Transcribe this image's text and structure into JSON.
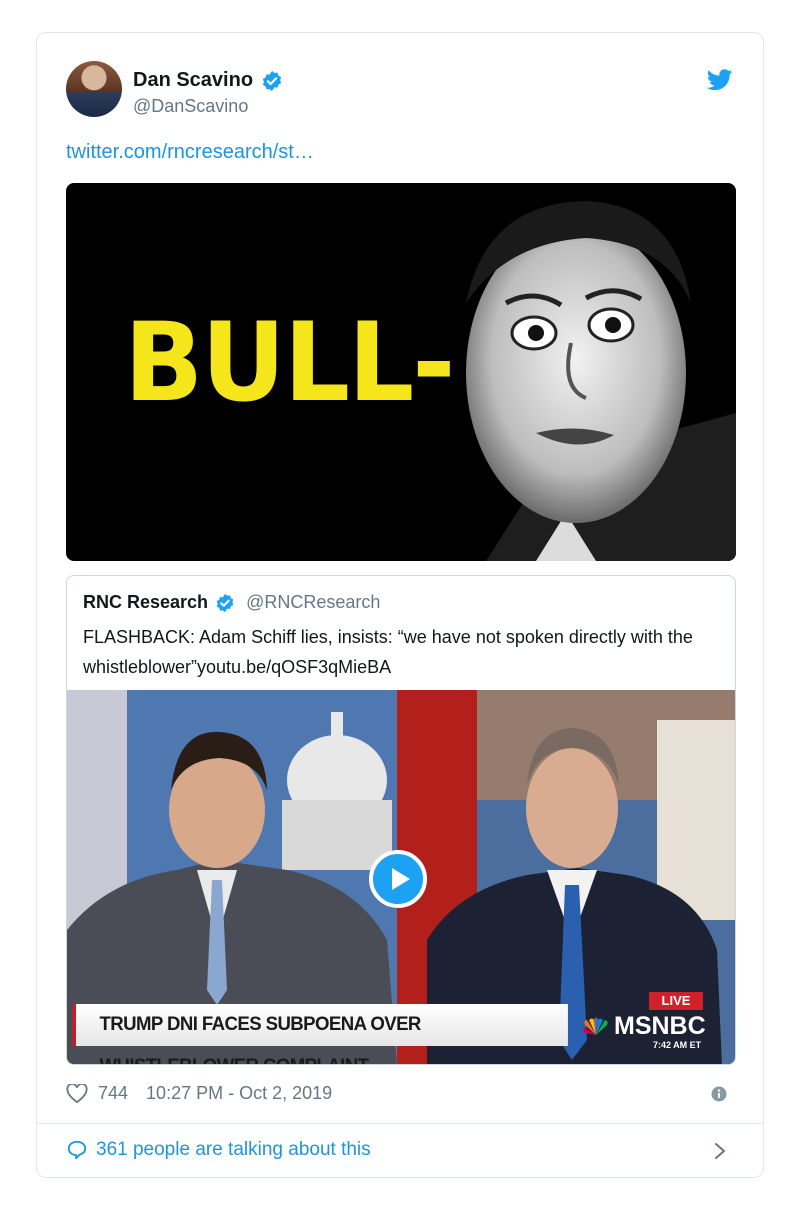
{
  "author": {
    "name": "Dan Scavino",
    "handle": "@DanScavino"
  },
  "tweet": {
    "link_text": "twitter.com/rncresearch/st…"
  },
  "image_text": "BULL-",
  "quoted": {
    "name": "RNC Research",
    "handle": "@RNCResearch",
    "text": "FLASHBACK: Adam Schiff lies, insists: “we have not spoken directly with the whistleblower”youtu.be/qOSF3qMieBA",
    "video": {
      "chyron": "TRUMP DNI FACES SUBPOENA OVER WHISTLEBLOWER COMPLAINT",
      "live_label": "LIVE",
      "network": "MSNBC",
      "timestamp": "7:42 AM ET"
    }
  },
  "meta": {
    "likes": "744",
    "time": "10:27 PM - Oct 2, 2019"
  },
  "footer": {
    "talking": "361 people are talking about this"
  },
  "colors": {
    "accent": "#1da1f2",
    "link": "#1b95e0",
    "muted": "#657786",
    "bull_yellow": "#f5e61c"
  },
  "icons": [
    "verified-icon",
    "twitter-bird-icon",
    "heart-icon",
    "info-icon",
    "speech-bubble-icon",
    "chevron-right-icon",
    "play-icon"
  ]
}
